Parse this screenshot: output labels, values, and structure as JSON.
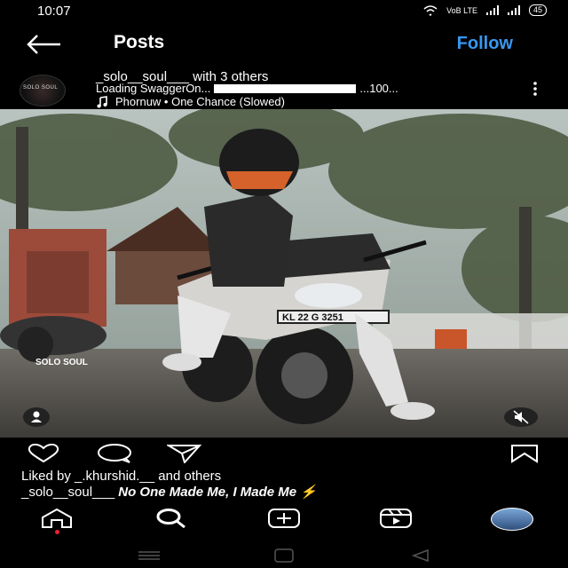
{
  "status_bar": {
    "time": "10:07",
    "network": "VoB LTE",
    "battery": "45"
  },
  "header": {
    "title": "Posts",
    "follow_label": "Follow"
  },
  "post": {
    "avatar_label": "SOLO SOUL",
    "username": "_solo__soul___",
    "with_text": "with",
    "others_text": "3 others",
    "caption_start": "Loading SwaggerOn...",
    "caption_end": "...100...",
    "music": "Phornuw • One Chance (Slowed)",
    "watermark": "SOLO SOUL",
    "plate": "KL 22 G 3251",
    "liked_by_prefix": "Liked by",
    "liked_by_user": "_.khurshid.__",
    "liked_by_suffix": "and others",
    "caption_user": "_solo__soul___",
    "caption_text": "No One Made Me, I Made Me ⚡"
  },
  "icons": [
    "back-arrow-icon",
    "more-icon",
    "tag-user-icon",
    "mute-icon",
    "heart-icon",
    "comment-icon",
    "share-icon",
    "bookmark-icon",
    "home-icon",
    "search-icon",
    "create-icon",
    "reels-icon",
    "profile-icon"
  ],
  "colors": {
    "accent": "#3897f0",
    "background": "#000000"
  }
}
